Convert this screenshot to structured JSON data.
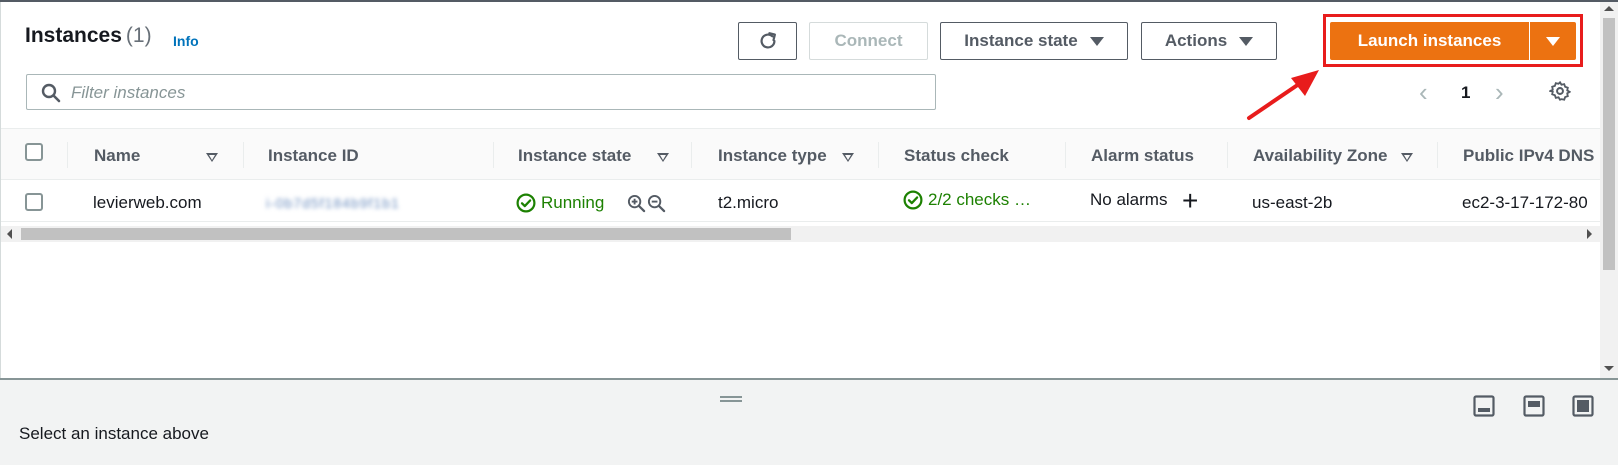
{
  "header": {
    "title": "Instances",
    "count": "(1)",
    "info_label": "Info"
  },
  "toolbar": {
    "refresh_icon": "refresh-icon",
    "connect_label": "Connect",
    "instance_state_label": "Instance state",
    "actions_label": "Actions",
    "launch_label": "Launch instances"
  },
  "search": {
    "placeholder": "Filter instances",
    "value": ""
  },
  "pagination": {
    "current_page": "1"
  },
  "table": {
    "columns": [
      "Name",
      "Instance ID",
      "Instance state",
      "Instance type",
      "Status check",
      "Alarm status",
      "Availability Zone",
      "Public IPv4 DNS"
    ],
    "rows": [
      {
        "name": "levierweb.com",
        "instance_id": "i-0b7d5f184b9f1b1",
        "instance_state": "Running",
        "instance_type": "t2.micro",
        "status_check": "2/2 checks …",
        "alarm_status": "No alarms",
        "availability_zone": "us-east-2b",
        "public_dns": "ec2-3-17-172-80"
      }
    ]
  },
  "bottom_panel": {
    "message": "Select an instance above"
  },
  "colors": {
    "accent_orange": "#ec7211",
    "link_blue": "#0073bb",
    "success_green": "#1d8102",
    "annotation_red": "#e81c1c"
  }
}
